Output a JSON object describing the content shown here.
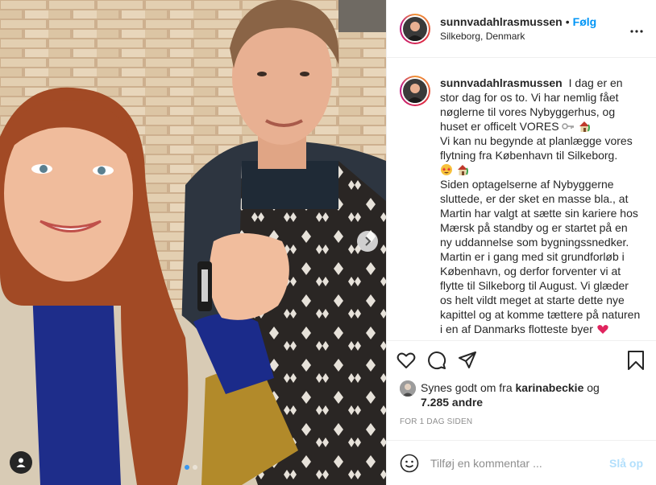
{
  "post": {
    "username": "sunnvadahlrasmussen",
    "separator": "•",
    "follow_label": "Følg",
    "location": "Silkeborg, Denmark",
    "more_icon": "more-horizontal-icon"
  },
  "caption": {
    "username": "sunnvadahlrasmussen",
    "para1": "I dag er en stor dag for os to. Vi har nemlig fået nøglerne til vores Nybyggerhus, og huset er officelt VORES",
    "para2": "Vi kan nu begynde at planlægge vores flytning fra København til Silkeborg.",
    "para3": "Siden optagelserne af Nybyggerne sluttede, er der sket en masse bla., at Martin har valgt at sætte sin kariere hos Mærsk på standby og er startet på en ny uddannelse som bygningssnedker. Martin er i gang med sit grundforløb i København, og derfor forventer vi at flytte til Silkeborg til August. Vi glæder os helt vildt meget at starte dette nye kapittel og at komme tættere på naturen i en af Danmarks flotteste byer",
    "emoji_key": "key-emoji",
    "emoji_house": "house-emoji",
    "emoji_star_eyes": "star-struck-emoji",
    "emoji_heart": "red-heart-emoji"
  },
  "actions": {
    "like": "heart-icon",
    "comment": "comment-icon",
    "share": "share-icon",
    "save": "bookmark-icon"
  },
  "likes": {
    "prefix": "Synes godt om fra",
    "liker": "karinabeckie",
    "conj": "og",
    "others": "7.285 andre"
  },
  "timestamp": "FOR 1 DAG SIDEN",
  "comment": {
    "placeholder": "Tilføj en kommentar ...",
    "post_label": "Slå op",
    "emoji_icon": "smiley-icon"
  },
  "carousel": {
    "slides": 2,
    "active_slide": 1
  },
  "colors": {
    "accent": "#0095f6",
    "post_disabled": "#b2dffc",
    "text": "#262626",
    "muted": "#8e8e8e",
    "carousel_active": "#3897f0"
  }
}
